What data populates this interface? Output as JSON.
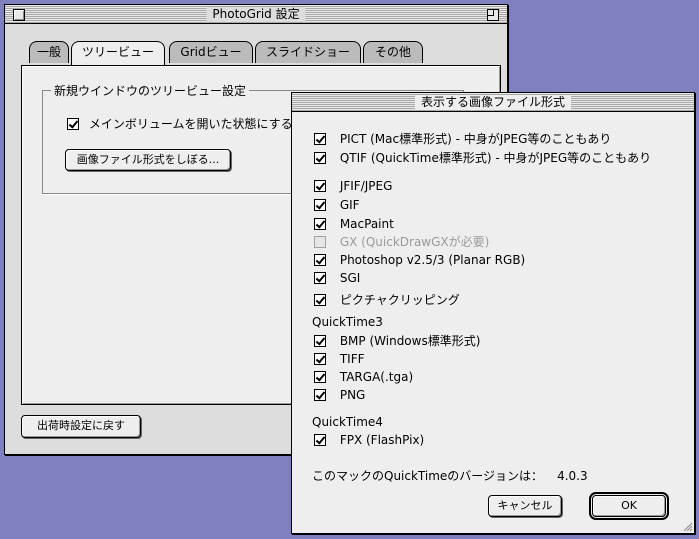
{
  "main_window": {
    "title": "PhotoGrid 設定",
    "tabs": [
      {
        "label": "一般"
      },
      {
        "label": "ツリービュー"
      },
      {
        "label": "Gridビュー"
      },
      {
        "label": "スライドショー"
      },
      {
        "label": "その他"
      }
    ],
    "group_label": "新規ウインドウのツリービュー設定",
    "open_main_volume_label": "メインボリュームを開いた状態にする",
    "filter_button_label": "画像ファイル形式をしぼる...",
    "restore_defaults_label": "出荷時設定に戻す"
  },
  "dialog": {
    "title": "表示する画像ファイル形式",
    "formats_group1": [
      {
        "label": "PICT (Mac標準形式) - 中身がJPEG等のこともあり",
        "checked": true
      },
      {
        "label": "QTIF (QuickTime標準形式) - 中身がJPEG等のこともあり",
        "checked": true
      }
    ],
    "formats_group2": [
      {
        "label": "JFIF/JPEG",
        "checked": true
      },
      {
        "label": "GIF",
        "checked": true
      },
      {
        "label": "MacPaint",
        "checked": true
      },
      {
        "label": "GX (QuickDrawGXが必要)",
        "checked": false,
        "disabled": true
      },
      {
        "label": "Photoshop v2.5/3 (Planar RGB)",
        "checked": true
      },
      {
        "label": "SGI",
        "checked": true
      },
      {
        "label": "ピクチャクリッピング",
        "checked": true
      }
    ],
    "qt3_heading": "QuickTime3",
    "qt3_formats": [
      {
        "label": "BMP (Windows標準形式)",
        "checked": true
      },
      {
        "label": "TIFF",
        "checked": true
      },
      {
        "label": "TARGA(.tga)",
        "checked": true
      },
      {
        "label": "PNG",
        "checked": true
      }
    ],
    "qt4_heading": "QuickTime4",
    "qt4_formats": [
      {
        "label": "FPX (FlashPix)",
        "checked": true
      }
    ],
    "version_label": "このマックのQuickTimeのバージョンは：",
    "version_value": "4.0.3",
    "cancel_label": "キャンセル",
    "ok_label": "OK"
  }
}
